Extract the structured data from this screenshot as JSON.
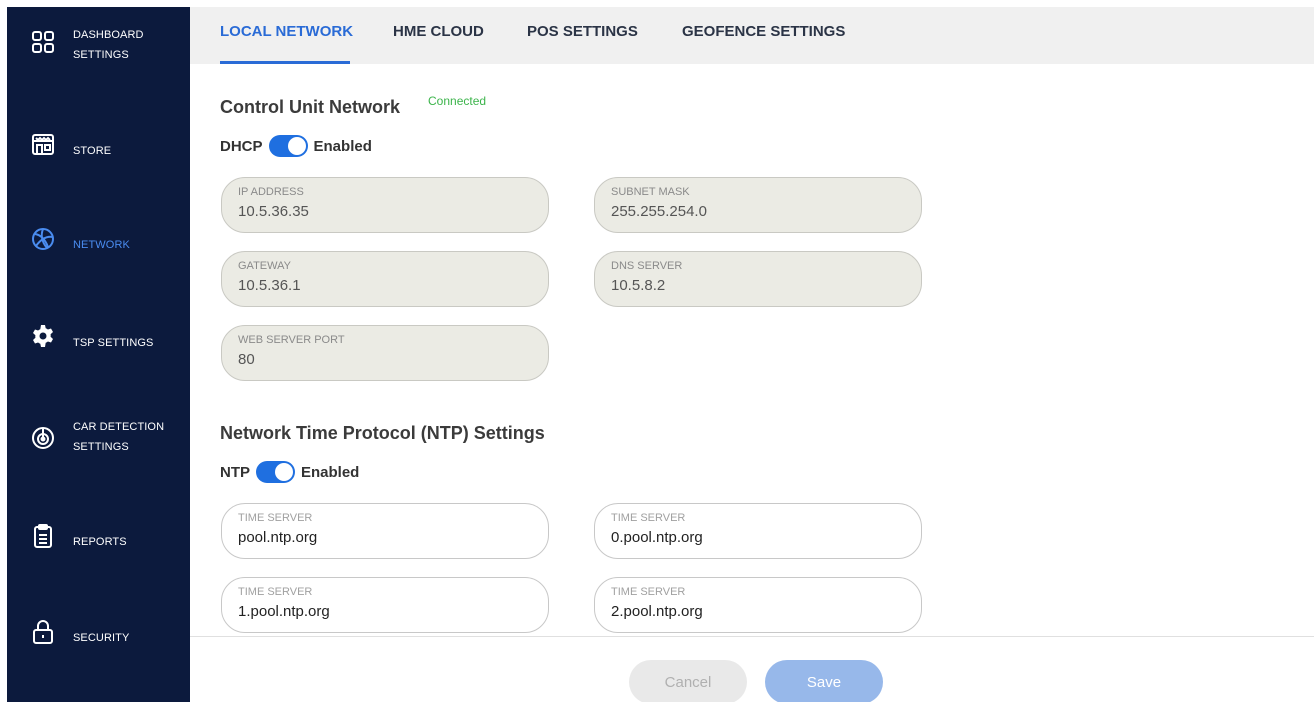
{
  "sidebar": {
    "items": [
      {
        "label_line1": "DASHBOARD",
        "label_line2": "SETTINGS",
        "icon": "dashboard-grid-icon",
        "active": false
      },
      {
        "label_line1": "STORE",
        "label_line2": "",
        "icon": "store-icon",
        "active": false
      },
      {
        "label_line1": "NETWORK",
        "label_line2": "",
        "icon": "network-globe-icon",
        "active": true
      },
      {
        "label_line1": "TSP SETTINGS",
        "label_line2": "",
        "icon": "gear-icon",
        "active": false
      },
      {
        "label_line1": "CAR DETECTION",
        "label_line2": "SETTINGS",
        "icon": "radar-icon",
        "active": false
      },
      {
        "label_line1": "REPORTS",
        "label_line2": "",
        "icon": "clipboard-icon",
        "active": false
      },
      {
        "label_line1": "SECURITY",
        "label_line2": "",
        "icon": "lock-icon",
        "active": false
      }
    ]
  },
  "tabs": [
    {
      "label": "LOCAL NETWORK",
      "active": true
    },
    {
      "label": "HME CLOUD",
      "active": false
    },
    {
      "label": "POS SETTINGS",
      "active": false
    },
    {
      "label": "GEOFENCE SETTINGS",
      "active": false
    }
  ],
  "control_unit": {
    "title": "Control Unit Network",
    "status": "Connected",
    "dhcp_label": "DHCP",
    "dhcp_state": "Enabled",
    "fields": {
      "ip_address": {
        "label": "IP ADDRESS",
        "value": "10.5.36.35"
      },
      "subnet_mask": {
        "label": "SUBNET MASK",
        "value": "255.255.254.0"
      },
      "gateway": {
        "label": "GATEWAY",
        "value": "10.5.36.1"
      },
      "dns_server": {
        "label": "DNS SERVER",
        "value": "10.5.8.2"
      },
      "web_server_port": {
        "label": "WEB SERVER PORT",
        "value": "80"
      }
    }
  },
  "ntp": {
    "title": "Network Time Protocol (NTP) Settings",
    "ntp_label": "NTP",
    "ntp_state": "Enabled",
    "servers": [
      {
        "label": "TIME SERVER",
        "value": "pool.ntp.org"
      },
      {
        "label": "TIME SERVER",
        "value": "0.pool.ntp.org"
      },
      {
        "label": "TIME SERVER",
        "value": "1.pool.ntp.org"
      },
      {
        "label": "TIME SERVER",
        "value": "2.pool.ntp.org"
      }
    ]
  },
  "footer": {
    "cancel_label": "Cancel",
    "save_label": "Save"
  },
  "colors": {
    "sidebar_bg": "#0c1a3d",
    "accent": "#2a6bd6",
    "connected": "#3cb44b"
  }
}
